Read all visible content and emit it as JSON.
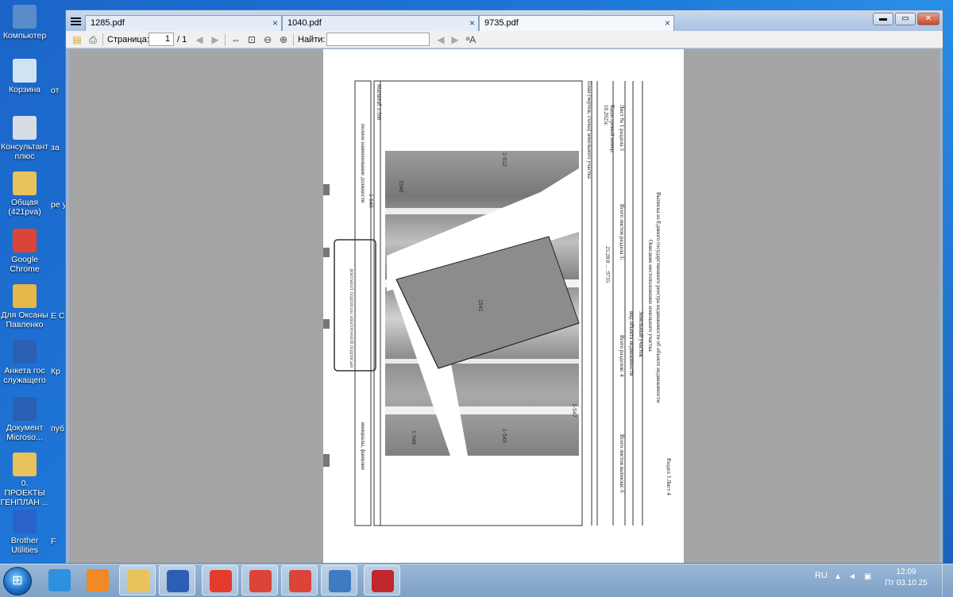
{
  "desktop": {
    "icons": [
      {
        "label": "Компьютер",
        "glyph": "monitor",
        "color": "#5a8cc8"
      },
      {
        "label": "Корзина",
        "glyph": "recycle-bin",
        "color": "#cfe3f3"
      },
      {
        "label": "Консультант плюс",
        "glyph": "consultant",
        "color": "#d7dde5"
      },
      {
        "label": "Общая (421pva)",
        "glyph": "folder",
        "color": "#e8c25a"
      },
      {
        "label": "Google Chrome",
        "glyph": "chrome",
        "color": "#db4437"
      },
      {
        "label": "Для Оксаны Павленко",
        "glyph": "folder-doc",
        "color": "#e6b84c"
      },
      {
        "label": "Анкета гос служащего",
        "glyph": "word-doc",
        "color": "#2b5fb4"
      },
      {
        "label": "Документ Microso...",
        "glyph": "word-doc",
        "color": "#2b5fb4"
      },
      {
        "label": "0. ПРОЕКТЫ ГЕНПЛАН ...",
        "glyph": "folder",
        "color": "#e8c25a"
      },
      {
        "label": "Brother Utilities",
        "glyph": "brother",
        "color": "#2a62c9"
      }
    ],
    "edge_labels": [
      "от",
      "за",
      "ре утв",
      "E C",
      "Кр",
      "пуб",
      "F"
    ]
  },
  "window": {
    "tabs": [
      {
        "label": "1285.pdf",
        "close": "×"
      },
      {
        "label": "1040.pdf",
        "close": "×"
      },
      {
        "label": "9735.pdf",
        "close": "×"
      }
    ],
    "controls": {
      "minimize": "▬",
      "maximize": "▭",
      "close": "✕"
    }
  },
  "toolbar": {
    "page_label": "Страница:",
    "page_value": "1",
    "page_total": "/ 1",
    "find_label": "Найти:",
    "find_value": ""
  },
  "document": {
    "title_lines": [
      "Выписка из Единого государственного реестра недвижимости об объекте недвижимости",
      "Описание местоположения земельного участка",
      "Земельный участок",
      "вид объекта недвижимости"
    ],
    "sheet_info": "Лист № 1 раздела 3",
    "total_sheets_section": "Всего листов раздела 3:",
    "total_sections": "Всего разделов: 4",
    "total_sheets_extract": "Всего листов выписки: 6",
    "cadastral_number_label": "Кадастровый номер:",
    "cadastral_number": "25:28:0 ... :9735",
    "plan_label": "План (чертеж, схема) земельного участка",
    "scale": "Масштаб 1:500",
    "section_label": "Раздел 3 Лист 4",
    "date_fragment": "10.2025г.",
    "signature_box": "ДОКУМЕНТ ПОДПИСАН ЭЛЕКТРОННОЙ ПОДПИСЬЮ",
    "footer_left": "полное наименование должности",
    "footer_right": "инициалы, фамилия",
    "plan_numbers": [
      "1-512",
      "1546",
      "1541",
      "1-548",
      "1-549",
      "1-547",
      "1-546"
    ]
  },
  "taskbar": {
    "apps": [
      {
        "name": "internet-explorer",
        "color": "#2f8fe0"
      },
      {
        "name": "media-player",
        "color": "#f08a24"
      },
      {
        "name": "explorer",
        "color": "#e8c25a"
      },
      {
        "name": "word",
        "color": "#2b5fb4"
      },
      {
        "name": "yandex",
        "color": "#e53b2c"
      },
      {
        "name": "chrome",
        "color": "#db4437"
      },
      {
        "name": "chrome-2",
        "color": "#db4437"
      },
      {
        "name": "image-viewer",
        "color": "#3f7bbf"
      },
      {
        "name": "pdf-viewer",
        "color": "#c0262b"
      }
    ],
    "language": "RU",
    "time": "12:09",
    "date": "Пт 03.10.25"
  },
  "colors": {
    "accent": "#1e78d8",
    "tab_bg": "#e3ecf7",
    "viewport": "#a5a5a5"
  }
}
